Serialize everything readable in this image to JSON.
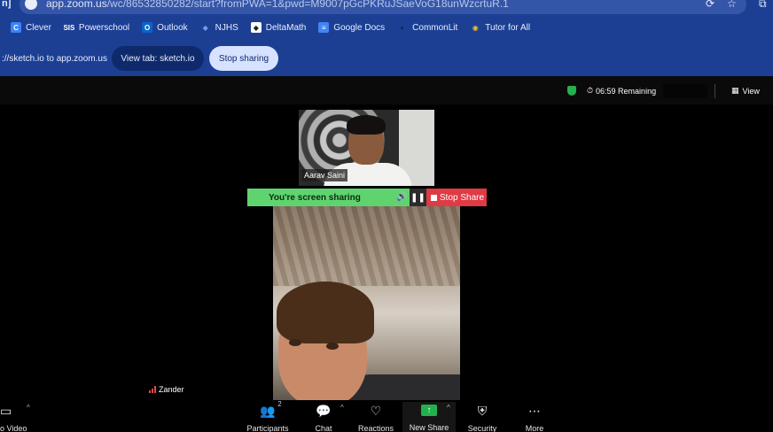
{
  "browser": {
    "left_fragment": "n]",
    "url_host": "app.zoom.us",
    "url_path": "/wc/86532850282/start?fromPWA=1&pwd=M9007pGcPKRuJSaeVoG18unWzcrtuR.1",
    "bookmarks": [
      {
        "label": "Clever",
        "icon": "C",
        "icon_color": "#3b82f6",
        "icon_text_color": "#ffffff"
      },
      {
        "label": "Powerschool",
        "icon": "SIS",
        "icon_color": "#1c3f94",
        "icon_text_color": "#ffffff"
      },
      {
        "label": "Outlook",
        "icon": "O",
        "icon_color": "#0a64c8",
        "icon_text_color": "#ffffff"
      },
      {
        "label": "NJHS",
        "icon": "◆",
        "icon_color": "#1c3f94",
        "icon_text_color": "#6fa0e8"
      },
      {
        "label": "DeltaMath",
        "icon": "◆",
        "icon_color": "#ffffff",
        "icon_text_color": "#222222"
      },
      {
        "label": "Google Docs",
        "icon": "≡",
        "icon_color": "#4285f4",
        "icon_text_color": "#ffffff"
      },
      {
        "label": "CommonLit",
        "icon": "◐",
        "icon_color": "#1c3f94",
        "icon_text_color": "#0d1b3f"
      },
      {
        "label": "Tutor for All",
        "icon": "◉",
        "icon_color": "#1c3f94",
        "icon_text_color": "#f0c040"
      }
    ]
  },
  "share_banner": {
    "message": "://sketch.io to app.zoom.us",
    "view_tab_label": "View tab: sketch.io",
    "stop_sharing_label": "Stop sharing"
  },
  "meeting": {
    "timer": "06:59 Remaining",
    "timer_icon": "⏱",
    "view_label": "View",
    "view_icon": "▦",
    "participants": {
      "aarav": {
        "name": "Aarav Saini"
      },
      "zander": {
        "name": "Zander"
      }
    },
    "sharing": {
      "status": "You're screen sharing",
      "speaker_icon": "🔊",
      "pause_icon": "❚❚",
      "stop_label": "Stop Share"
    },
    "toolbar": {
      "video_label": "o Video",
      "video_icon": "▭",
      "participants_label": "Participants",
      "participants_icon": "👥",
      "participants_count": "2",
      "chat_label": "Chat",
      "chat_icon": "💬",
      "reactions_label": "Reactions",
      "reactions_icon": "♡",
      "new_share_label": "New Share",
      "new_share_icon": "↑",
      "security_label": "Security",
      "security_icon": "⛨",
      "more_label": "More",
      "more_icon": "⋯",
      "caret": "^"
    }
  },
  "colors": {
    "chrome_blue": "#1c3f94",
    "sharing_green": "#5fd46e",
    "stop_red": "#e03a44",
    "shield_green": "#23b14d"
  }
}
